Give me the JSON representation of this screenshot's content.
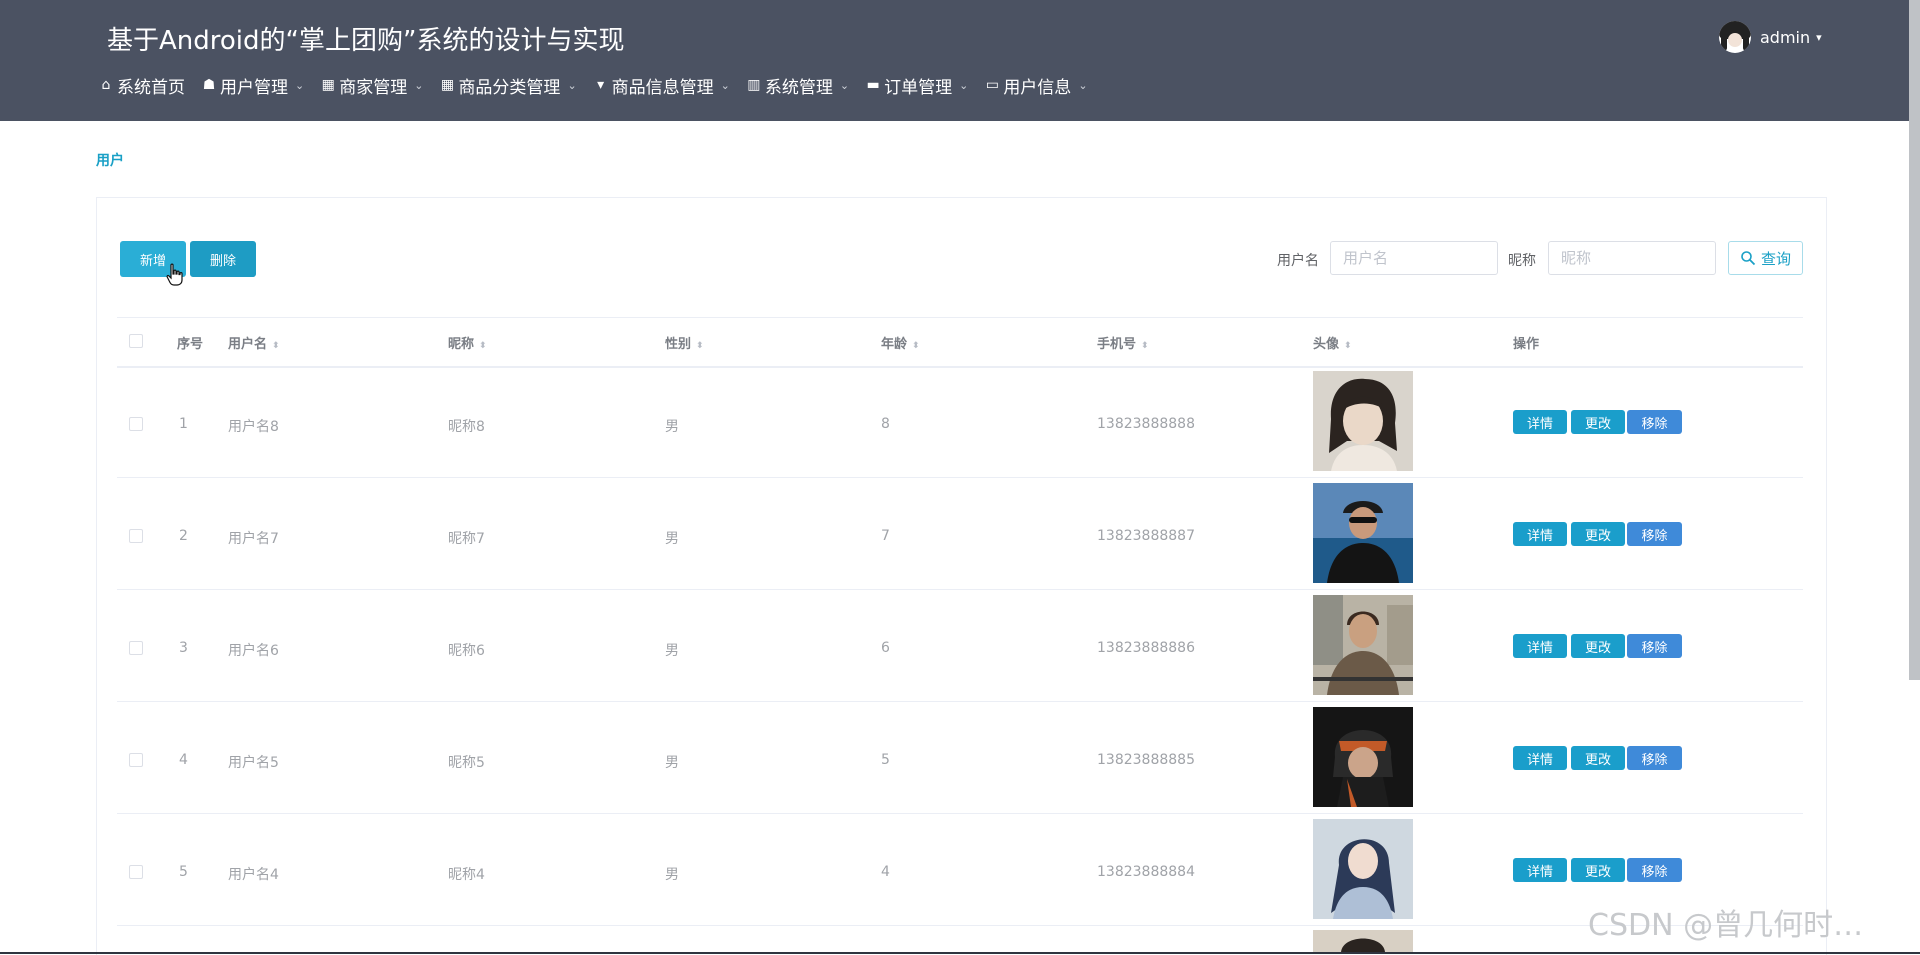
{
  "header": {
    "title": "基于Android的“掌上团购”系统的设计与实现",
    "user": {
      "name": "admin",
      "caret": "▾"
    },
    "nav": [
      {
        "icon": "home-icon",
        "glyph": "⌂",
        "label": "系统首页",
        "dropdown": ""
      },
      {
        "icon": "user-icon",
        "glyph": "☗",
        "label": "用户管理",
        "dropdown": "⌄"
      },
      {
        "icon": "grid-icon",
        "glyph": "▦",
        "label": "商家管理",
        "dropdown": "⌄"
      },
      {
        "icon": "grid-icon",
        "glyph": "▦",
        "label": "商品分类管理",
        "dropdown": "⌄"
      },
      {
        "icon": "goods-icon",
        "glyph": "▾",
        "label": "商品信息管理",
        "dropdown": "⌄"
      },
      {
        "icon": "system-icon",
        "glyph": "▥",
        "label": "系统管理",
        "dropdown": "⌄"
      },
      {
        "icon": "order-icon",
        "glyph": "▬",
        "label": "订单管理",
        "dropdown": "⌄"
      },
      {
        "icon": "card-icon",
        "glyph": "▭",
        "label": "用户信息",
        "dropdown": "⌄"
      }
    ]
  },
  "breadcrumb": "用户",
  "toolbar": {
    "add_label": "新增",
    "delete_label": "删除"
  },
  "search": {
    "username_label": "用户名",
    "username_placeholder": "用户名",
    "nickname_label": "昵称",
    "nickname_placeholder": "昵称",
    "query_label": "查询"
  },
  "table": {
    "columns": {
      "index": "序号",
      "username": "用户名",
      "nickname": "昵称",
      "gender": "性别",
      "age": "年龄",
      "phone": "手机号",
      "avatar": "头像",
      "actions": "操作"
    },
    "sort_glyph": "⬍",
    "action_labels": {
      "detail": "详情",
      "edit": "更改",
      "remove": "移除"
    },
    "rows": [
      {
        "index": "1",
        "username": "用户名8",
        "nickname": "昵称8",
        "gender": "男",
        "age": "8",
        "phone": "13823888888"
      },
      {
        "index": "2",
        "username": "用户名7",
        "nickname": "昵称7",
        "gender": "男",
        "age": "7",
        "phone": "13823888887"
      },
      {
        "index": "3",
        "username": "用户名6",
        "nickname": "昵称6",
        "gender": "男",
        "age": "6",
        "phone": "13823888886"
      },
      {
        "index": "4",
        "username": "用户名5",
        "nickname": "昵称5",
        "gender": "男",
        "age": "5",
        "phone": "13823888885"
      },
      {
        "index": "5",
        "username": "用户名4",
        "nickname": "昵称4",
        "gender": "男",
        "age": "4",
        "phone": "13823888884"
      }
    ]
  },
  "watermark": "CSDN @曾几何时…",
  "colors": {
    "header_bg": "#4b5262",
    "accent": "#1aa0c6",
    "remove_button": "#3f8ad9"
  }
}
